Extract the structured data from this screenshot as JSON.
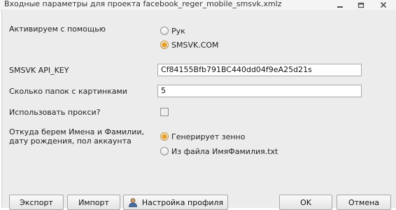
{
  "window": {
    "title": "Входные параметры для проекта facebook_reger_mobile_smsvk.xmlz",
    "icons": [
      "minimize-icon",
      "restore-icon",
      "close-icon"
    ]
  },
  "form": {
    "activate_label": "Активируем с помощью",
    "activate_options": [
      {
        "label": "Рук",
        "checked": false
      },
      {
        "label": "SMSVK.COM",
        "checked": true
      }
    ],
    "api_key_label": "SMSVK API_KEY",
    "api_key_value": "Cf84155Bfb791BC440dd04f9eA25d21s",
    "folders_label": "Сколько папок с картинками",
    "folders_value": "5",
    "proxy_label": "Использовать прокси?",
    "proxy_checked": false,
    "names_label_line1": "Откуда берем Имена и Фамилии,",
    "names_label_line2": "дату рождения, пол аккаунта",
    "names_options": [
      {
        "label": "Генерирует зенно",
        "checked": true
      },
      {
        "label": "Из файла ИмяФамилия.txt",
        "checked": false
      }
    ]
  },
  "buttons": {
    "export": "Экспорт",
    "import": "Импорт",
    "profile": "Настройка профиля",
    "ok": "OK",
    "cancel": "Отмена"
  },
  "colors": {
    "accent": "#f0a020",
    "dialog_bg": "#ececec"
  }
}
